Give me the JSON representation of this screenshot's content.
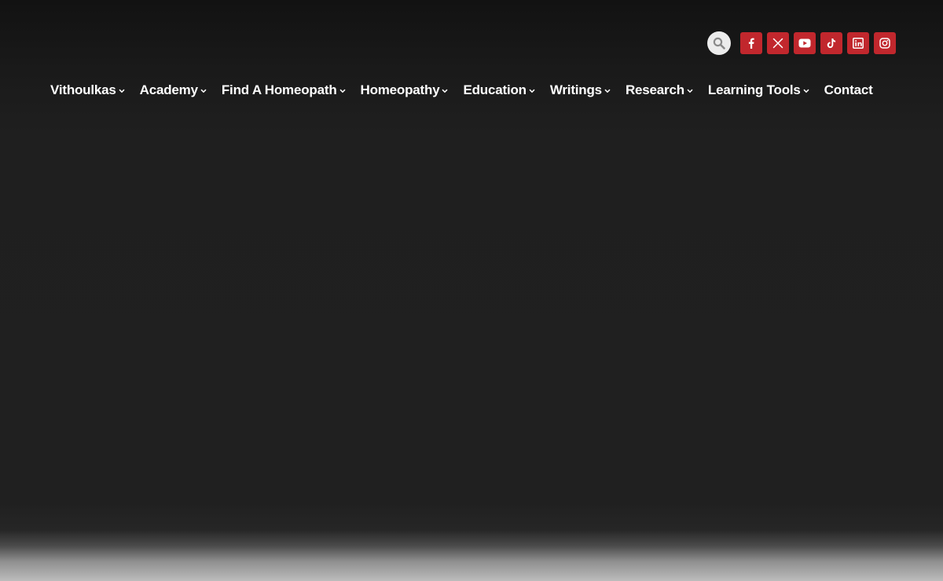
{
  "colors": {
    "accent": "#c1272d",
    "nav_text": "#ffffff",
    "search_bg": "#ececec",
    "background_top": "#121212",
    "background_main": "#202020"
  },
  "search": {
    "icon": "search-icon"
  },
  "social": [
    {
      "name": "facebook",
      "icon": "facebook-icon"
    },
    {
      "name": "x",
      "icon": "x-icon"
    },
    {
      "name": "youtube",
      "icon": "youtube-icon"
    },
    {
      "name": "tiktok",
      "icon": "tiktok-icon"
    },
    {
      "name": "linkedin",
      "icon": "linkedin-icon"
    },
    {
      "name": "instagram",
      "icon": "instagram-icon"
    }
  ],
  "nav": {
    "items": [
      {
        "label": "Vithoulkas",
        "has_dropdown": true
      },
      {
        "label": "Academy",
        "has_dropdown": true
      },
      {
        "label": "Find A Homeopath",
        "has_dropdown": true
      },
      {
        "label": "Homeopathy",
        "has_dropdown": true
      },
      {
        "label": "Education",
        "has_dropdown": true
      },
      {
        "label": "Writings",
        "has_dropdown": true
      },
      {
        "label": "Research",
        "has_dropdown": true
      },
      {
        "label": "Learning Tools",
        "has_dropdown": true
      },
      {
        "label": "Contact",
        "has_dropdown": false
      }
    ]
  }
}
